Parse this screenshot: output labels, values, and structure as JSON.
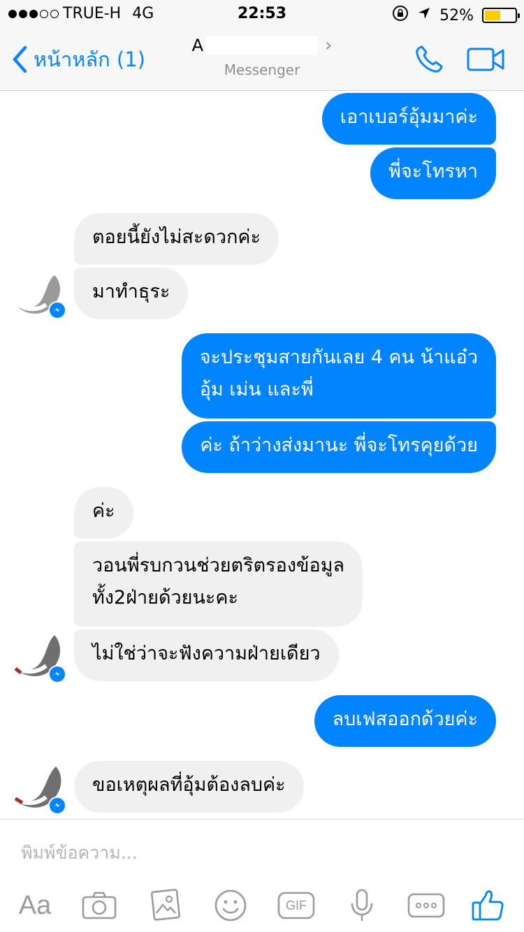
{
  "status_bar": {
    "carrier": "TRUE-H",
    "network": "4G",
    "time": "22:53",
    "battery_percent": "52%",
    "battery_level": 0.52,
    "signal_bars_filled": 3,
    "signal_bars_total": 5
  },
  "nav": {
    "back_label": "หน้าหลัก (1)",
    "title_visible": "A",
    "title_chevron": "›",
    "subtitle": "Messenger"
  },
  "messages": [
    {
      "side": "out",
      "text": "เอาเบอร์อุ้มมาค่ะ"
    },
    {
      "side": "out",
      "text": "พี่จะโทรหา"
    },
    {
      "side": "in",
      "text": "ตอยนี้ยังไม่สะดวกค่ะ"
    },
    {
      "side": "in",
      "text": "มาทำธุระ"
    },
    {
      "side": "out",
      "lines": [
        "จะประชุมสายกันเลย 4 คน น้าแอ๋ว",
        "อุ้ม เม่น และพี่"
      ]
    },
    {
      "side": "out",
      "text": "ค่ะ ถ้าว่างส่งมานะ พี่จะโทรคุยด้วย"
    },
    {
      "side": "in",
      "text": "ค่ะ"
    },
    {
      "side": "in",
      "lines": [
        "วอนพี่รบกวนช่วยตริตรองข้อมูล",
        "ทั้ง2ฝ่ายด้วยนะคะ"
      ]
    },
    {
      "side": "in",
      "text": "ไม่ใช่ว่าจะฟังความฝ่ายเดียว"
    },
    {
      "side": "out",
      "text": "ลบเฟสออกด้วยค่ะ"
    },
    {
      "side": "in",
      "text": "ขอเหตุผลที่อุ้มต้องลบค่ะ"
    }
  ],
  "composer": {
    "placeholder": "พิมพ์ข้อความ...",
    "aa_label": "Aa",
    "gif_label": "GIF"
  },
  "colors": {
    "accent": "#0084ff",
    "ios_blue": "#0a84ff",
    "incoming_bubble": "#f1f0f0",
    "battery": "#ffcc00"
  }
}
